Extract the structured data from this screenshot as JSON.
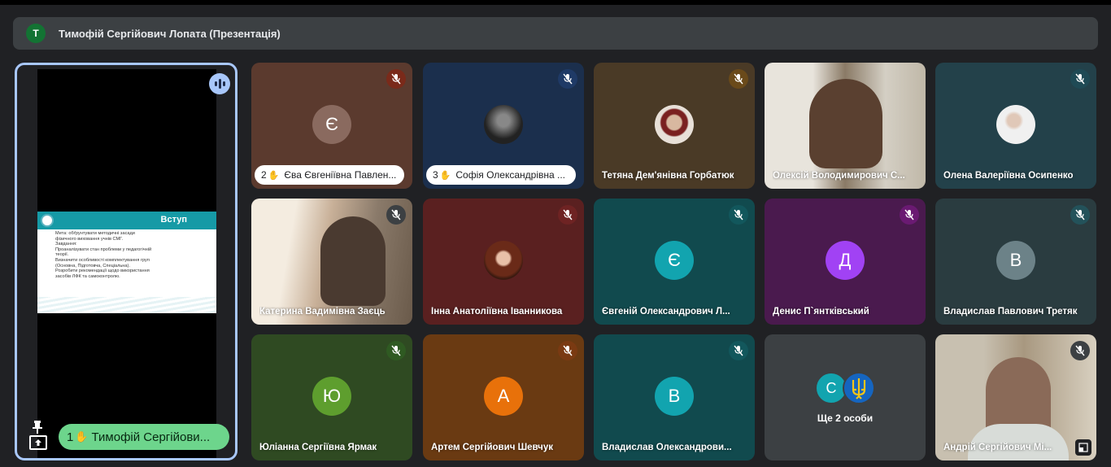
{
  "presenter_bar": {
    "avatar_letter": "T",
    "title": "Тимофій Сергійович Лопата (Презентація)"
  },
  "presentation": {
    "slide_title": "Вступ",
    "slide_body": "Мета: обґрунтувати методичні засади\nфізичного виховання учнів СМГ.\nЗавдання:\nПроаналізувати стан проблеми у педагогічній\nтеорії.\nВизначити особливості комплектування груп\n(Основна, Підготовча, Спеціальна).\nРозробити рекомендації щодо використання\nзасобів ЛФК та самоконтролю.",
    "presenter_hand_num": "1",
    "presenter_name": "Тимофій Сергійови..."
  },
  "tiles": [
    {
      "name": "Єва Євгеніївна Павлен...",
      "hand_num": "2",
      "initial": "Є",
      "bg": "#5b3a2e",
      "circle": "#8a6a5f",
      "mic_bg": "#7a2a1a"
    },
    {
      "name": "Софія Олександрівна ...",
      "hand_num": "3",
      "bg": "#1b2f4d",
      "mic_bg": "#1f3a66"
    },
    {
      "name": "Тетяна Дем'янівна Горбатюк",
      "bg": "#4a3a26",
      "mic_bg": "#6a4a1a"
    },
    {
      "name": "Олексій Володимирович С...",
      "bg": "#b8a890"
    },
    {
      "name": "Олена Валеріївна Осипенко",
      "bg": "#23414a",
      "mic_bg": "#1f4a55"
    },
    {
      "name": "Катерина Вадимівна Заєць",
      "bg": "#c9b8a5",
      "mic_bg": "#3c4043"
    },
    {
      "name": "Інна Анатоліївна Іванникова",
      "bg": "#5a2020",
      "mic_bg": "#6e2323"
    },
    {
      "name": "Євгеній Олександрович Л...",
      "initial": "Є",
      "bg": "#114a4e",
      "circle": "#12a4af",
      "mic_bg": "#12575c"
    },
    {
      "name": "Денис П`янтківський",
      "initial": "Д",
      "bg": "#4a1a4e",
      "circle": "#a142f4",
      "mic_bg": "#6a1a72"
    },
    {
      "name": "Владислав Павлович Третяк",
      "initial": "В",
      "bg": "#2a3c40",
      "circle": "#6c8288",
      "mic_bg": "#23525a"
    },
    {
      "name": "Юліанна Сергіївна Ярмак",
      "initial": "Ю",
      "bg": "#2f4a22",
      "circle": "#5e9e2e",
      "mic_bg": "#2f5a22"
    },
    {
      "name": "Артем Сергійович Шевчук",
      "initial": "А",
      "bg": "#6a3a12",
      "circle": "#e8710a",
      "mic_bg": "#7a3a12"
    },
    {
      "name": "Владислав Олександрови...",
      "initial": "В",
      "bg": "#114a4e",
      "circle": "#12a4af",
      "mic_bg": "#12575c"
    },
    {
      "more_initial": "С",
      "label": "Ще 2 особи",
      "bg": "#3c4043"
    },
    {
      "name": "Андрій Сергійович Мі...",
      "bg": "#a8a090",
      "mic_bg": "#3c4043"
    }
  ]
}
